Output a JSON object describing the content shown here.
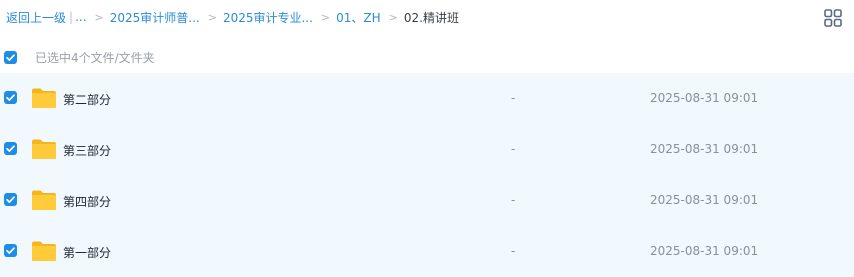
{
  "breadcrumb": {
    "back": "返回上一级",
    "pipe": "|",
    "ellipsis": "...",
    "sep": ">",
    "crumbs": [
      "2025审计师普...",
      "2025审计专业...",
      "01、ZH"
    ],
    "current": "02.精讲班"
  },
  "view_toggle": {
    "icon": "grid-view-icon"
  },
  "selection": {
    "text": "已选中4个文件/文件夹",
    "all_checked": true
  },
  "colors": {
    "accent": "#1f8ce8",
    "link": "#2b8cd9",
    "row_bg": "#f1f8fe",
    "folder": "#ffc933"
  },
  "files": [
    {
      "name": "第二部分",
      "size": "-",
      "date": "2025-08-31 09:01",
      "checked": true,
      "icon": "folder-icon"
    },
    {
      "name": "第三部分",
      "size": "-",
      "date": "2025-08-31 09:01",
      "checked": true,
      "icon": "folder-icon"
    },
    {
      "name": "第四部分",
      "size": "-",
      "date": "2025-08-31 09:01",
      "checked": true,
      "icon": "folder-icon"
    },
    {
      "name": "第一部分",
      "size": "-",
      "date": "2025-08-31 09:01",
      "checked": true,
      "icon": "folder-icon"
    }
  ]
}
